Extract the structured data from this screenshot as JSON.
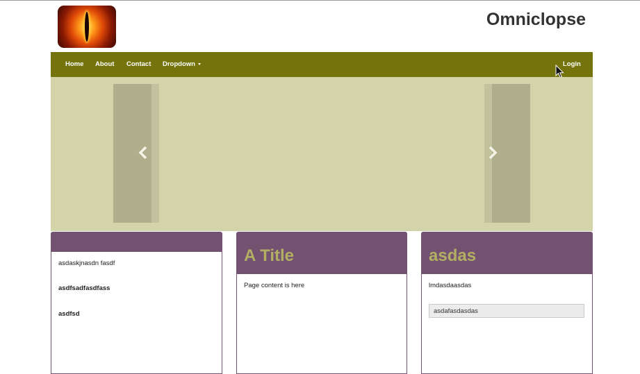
{
  "header": {
    "brand": "Omniclopse"
  },
  "nav": {
    "items": [
      {
        "label": "Home"
      },
      {
        "label": "About"
      },
      {
        "label": "Contact"
      },
      {
        "label": "Dropdown"
      }
    ],
    "login": "Login"
  },
  "carousel": {
    "prev_icon": "chevron-left-icon",
    "next_icon": "chevron-right-icon"
  },
  "panels": [
    {
      "title": "",
      "lines": [
        "asdaskjnasdn fasdf",
        "asdfsadfasdfass",
        "asdfsd"
      ]
    },
    {
      "title": "A Title",
      "text": "Page content is here"
    },
    {
      "title": "asdas",
      "text": "lmdasdaasdas",
      "input_value": "asdafasdasdas"
    }
  ],
  "colors": {
    "navbar": "#75740c",
    "carousel_bg": "#d3d4aa",
    "panel_header": "#735271",
    "panel_title": "#b3af62"
  }
}
